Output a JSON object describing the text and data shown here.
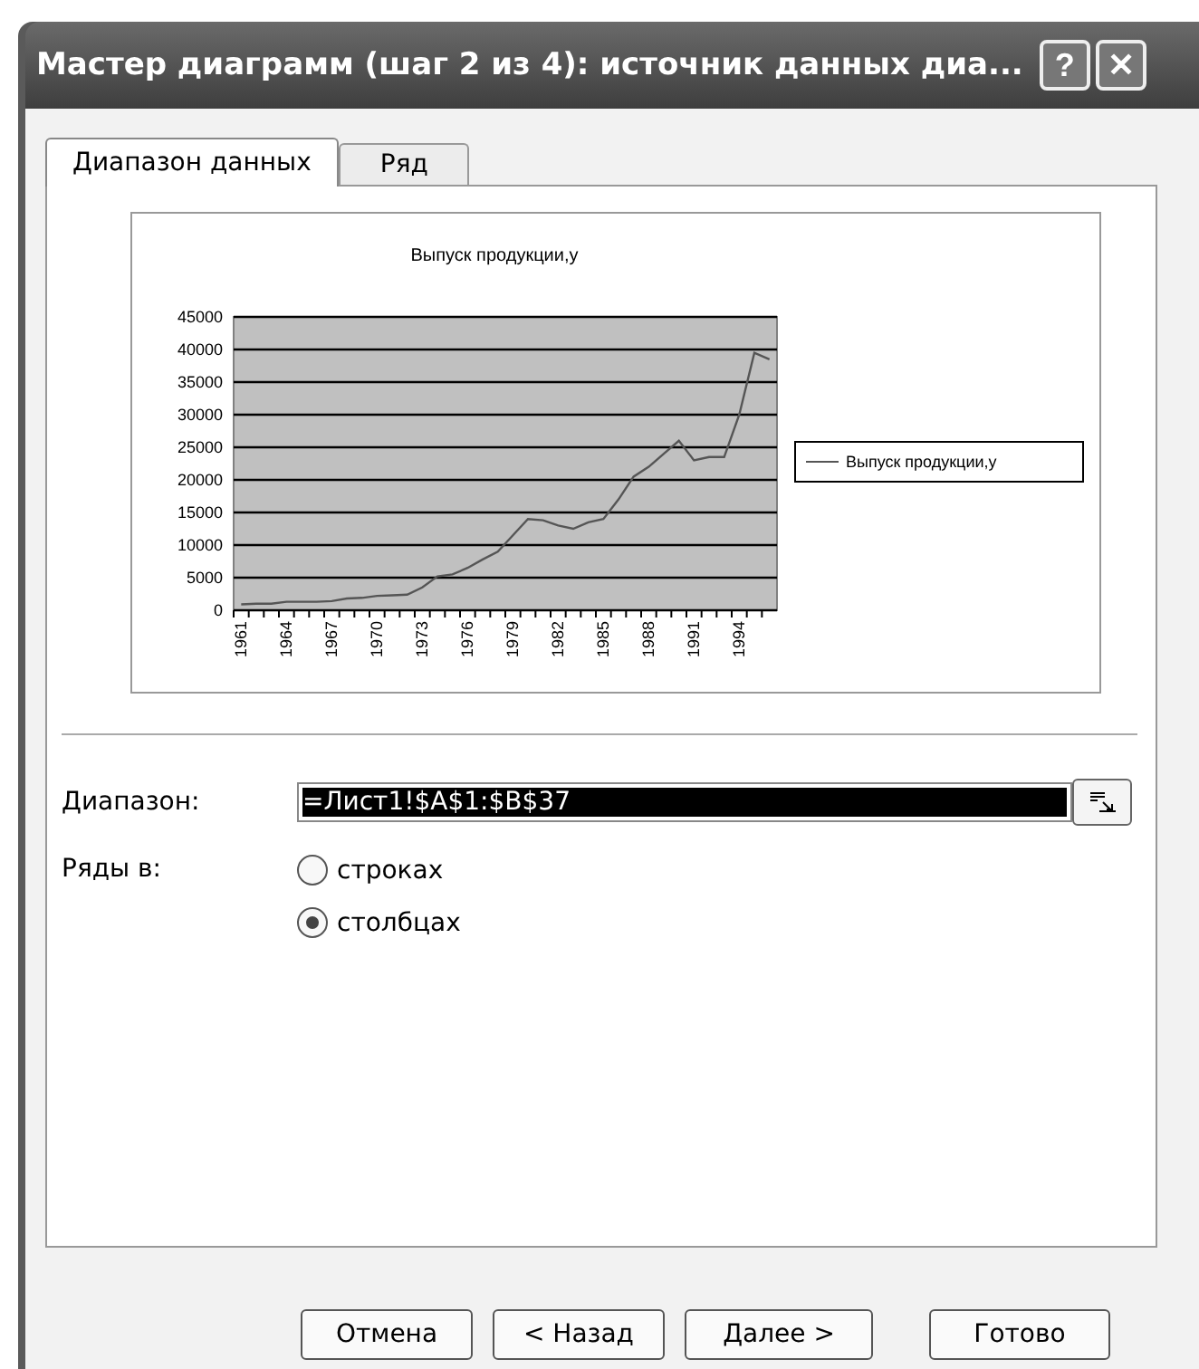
{
  "window": {
    "title": "Мастер диаграмм (шаг 2 из 4): источник данных диа...",
    "help_button": "?",
    "close_button": "✕"
  },
  "tabs": [
    {
      "label": "Диапазон данных",
      "selected": true
    },
    {
      "label": "Ряд",
      "selected": false
    }
  ],
  "chart_data": {
    "type": "line",
    "title": "Выпуск продукции,у",
    "grid": true,
    "x": [
      1961,
      1962,
      1963,
      1964,
      1965,
      1966,
      1967,
      1968,
      1969,
      1970,
      1971,
      1972,
      1973,
      1974,
      1975,
      1976,
      1977,
      1978,
      1979,
      1980,
      1981,
      1982,
      1983,
      1984,
      1985,
      1986,
      1987,
      1988,
      1989,
      1990,
      1991,
      1992,
      1993,
      1994,
      1995,
      1996
    ],
    "xlim": [
      1960.5,
      1996.5
    ],
    "series": [
      {
        "name": "Выпуск продукции,у",
        "color": "#555555",
        "values": [
          900,
          1000,
          1000,
          1300,
          1300,
          1300,
          1400,
          1800,
          1900,
          2200,
          2300,
          2400,
          3500,
          5200,
          5500,
          6500,
          7800,
          9000,
          11500,
          14000,
          13800,
          13000,
          12500,
          13500,
          14000,
          17000,
          20500,
          22000,
          24000,
          26000,
          23000,
          23500,
          23500,
          30000,
          39500,
          38500
        ]
      }
    ],
    "ylim": [
      0,
      45000
    ],
    "yticks": [
      0,
      5000,
      10000,
      15000,
      20000,
      25000,
      30000,
      35000,
      40000,
      45000
    ],
    "xticks": [
      1961,
      1964,
      1967,
      1970,
      1973,
      1976,
      1979,
      1982,
      1985,
      1988,
      1991,
      1994
    ]
  },
  "range": {
    "label": "Диапазон:",
    "value": "=Лист1!$A$1:$B$37"
  },
  "series_in": {
    "label": "Ряды в:",
    "options": [
      {
        "label": "строках",
        "selected": false
      },
      {
        "label": "столбцах",
        "selected": true
      }
    ]
  },
  "buttons": [
    "Отмена",
    "< Назад",
    "Далее >",
    "Готово"
  ]
}
